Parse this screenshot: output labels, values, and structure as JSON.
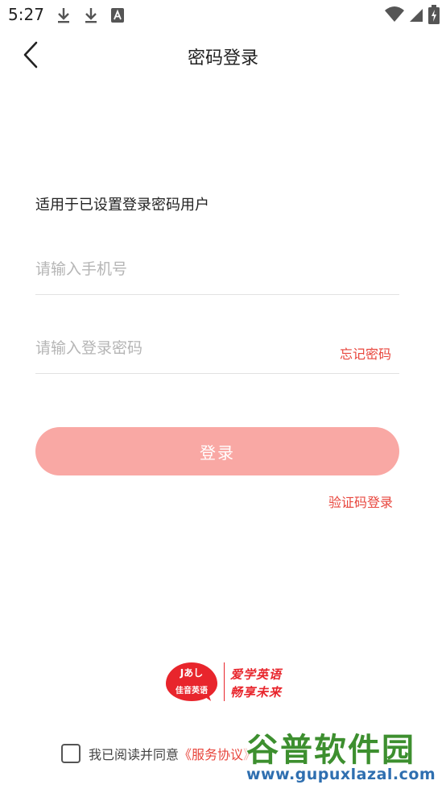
{
  "status_bar": {
    "time": "5:27",
    "icons": [
      "download-icon",
      "download-icon",
      "text-a-icon",
      "wifi-icon",
      "signal-icon",
      "battery-charging-icon"
    ]
  },
  "header": {
    "title": "密码登录",
    "back_icon": "chevron-left-icon"
  },
  "form": {
    "subtitle": "适用于已设置登录密码用户",
    "phone_placeholder": "请输入手机号",
    "password_placeholder": "请输入登录密码",
    "forgot_password": "忘记密码",
    "login_button": "登录",
    "sms_login": "验证码登录"
  },
  "logo": {
    "mark": "Jあし",
    "name": "佳音英语",
    "slogan_line1": "爱学英语",
    "slogan_line2": "畅享未来"
  },
  "agreement": {
    "prefix": "我已阅读并同意",
    "link": "《服务协议》"
  },
  "watermark": {
    "cn": "谷普软件园",
    "url": "www.gupuxlazal.com"
  },
  "colors": {
    "accent": "#e8453c",
    "button_disabled": "#f9a8a4",
    "brand_red": "#e8252c"
  }
}
